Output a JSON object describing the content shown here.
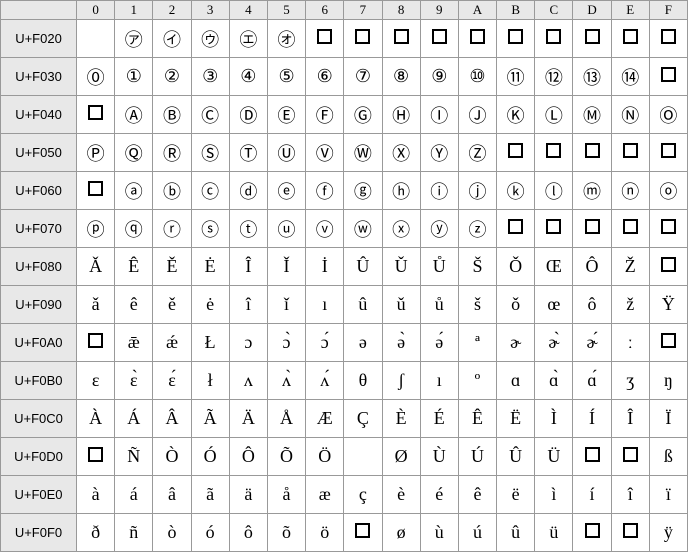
{
  "columns": [
    "0",
    "1",
    "2",
    "3",
    "4",
    "5",
    "6",
    "7",
    "8",
    "9",
    "A",
    "B",
    "C",
    "D",
    "E",
    "F"
  ],
  "rows": [
    {
      "label": "U+F020",
      "cells": [
        "",
        "㋐",
        "㋑",
        "㋒",
        "㋓",
        "㋔",
        "□",
        "□",
        "□",
        "□",
        "□",
        "□",
        "□",
        "□",
        "□",
        "□"
      ]
    },
    {
      "label": "U+F030",
      "cells": [
        "⓪",
        "①",
        "②",
        "③",
        "④",
        "⑤",
        "⑥",
        "⑦",
        "⑧",
        "⑨",
        "⑩",
        "⑪",
        "⑫",
        "⑬",
        "⑭",
        "□"
      ]
    },
    {
      "label": "U+F040",
      "cells": [
        "□",
        "Ⓐ",
        "Ⓑ",
        "Ⓒ",
        "Ⓓ",
        "Ⓔ",
        "Ⓕ",
        "Ⓖ",
        "Ⓗ",
        "Ⓘ",
        "Ⓙ",
        "Ⓚ",
        "Ⓛ",
        "Ⓜ",
        "Ⓝ",
        "Ⓞ"
      ]
    },
    {
      "label": "U+F050",
      "cells": [
        "Ⓟ",
        "Ⓠ",
        "Ⓡ",
        "Ⓢ",
        "Ⓣ",
        "Ⓤ",
        "Ⓥ",
        "Ⓦ",
        "Ⓧ",
        "Ⓨ",
        "Ⓩ",
        "□",
        "□",
        "□",
        "□",
        "□"
      ]
    },
    {
      "label": "U+F060",
      "cells": [
        "□",
        "ⓐ",
        "ⓑ",
        "ⓒ",
        "ⓓ",
        "ⓔ",
        "ⓕ",
        "ⓖ",
        "ⓗ",
        "ⓘ",
        "ⓙ",
        "ⓚ",
        "ⓛ",
        "ⓜ",
        "ⓝ",
        "ⓞ"
      ]
    },
    {
      "label": "U+F070",
      "cells": [
        "ⓟ",
        "ⓠ",
        "ⓡ",
        "ⓢ",
        "ⓣ",
        "ⓤ",
        "ⓥ",
        "ⓦ",
        "ⓧ",
        "ⓨ",
        "ⓩ",
        "□",
        "□",
        "□",
        "□",
        "□"
      ]
    },
    {
      "label": "U+F080",
      "cells": [
        "Ǎ",
        "Ê",
        "Ě",
        "Ė",
        "Î",
        "Ǐ",
        "İ",
        "Û",
        "Ǔ",
        "Ů",
        "Š",
        "Ǒ",
        "Œ",
        "Ô",
        "Ž",
        "□"
      ]
    },
    {
      "label": "U+F090",
      "cells": [
        "ǎ",
        "ê",
        "ě",
        "ė",
        "î",
        "ǐ",
        "ı",
        "û",
        "ǔ",
        "ů",
        "š",
        "ǒ",
        "œ",
        "ô",
        "ž",
        "Ÿ"
      ]
    },
    {
      "label": "U+F0A0",
      "cells": [
        "□",
        "ǣ",
        "ǽ",
        "Ł",
        "ɔ",
        "ɔ̀",
        "ɔ́",
        "ə",
        "ə̀",
        "ə́",
        "ª",
        "ɚ",
        "ɚ̀",
        "ɚ́",
        "ː",
        "□"
      ]
    },
    {
      "label": "U+F0B0",
      "cells": [
        "ɛ",
        "ɛ̀",
        "ɛ́",
        "ł",
        "ʌ",
        "ʌ̀",
        "ʌ́",
        "θ",
        "ʃ",
        "ı",
        "º",
        "ɑ",
        "ɑ̀",
        "ɑ́",
        "ʒ",
        "ŋ"
      ]
    },
    {
      "label": "U+F0C0",
      "cells": [
        "À",
        "Á",
        "Â",
        "Ã",
        "Ä",
        "Å",
        "Æ",
        "Ç",
        "È",
        "É",
        "Ê",
        "Ë",
        "Ì",
        "Í",
        "Î",
        "Ï"
      ]
    },
    {
      "label": "U+F0D0",
      "cells": [
        "□",
        "Ñ",
        "Ò",
        "Ó",
        "Ô",
        "Õ",
        "Ö",
        "",
        "Ø",
        "Ù",
        "Ú",
        "Û",
        "Ü",
        "□",
        "□",
        "ß"
      ]
    },
    {
      "label": "U+F0E0",
      "cells": [
        "à",
        "á",
        "â",
        "ã",
        "ä",
        "å",
        "æ",
        "ç",
        "è",
        "é",
        "ê",
        "ë",
        "ì",
        "í",
        "î",
        "ï"
      ]
    },
    {
      "label": "U+F0F0",
      "cells": [
        "ð",
        "ñ",
        "ò",
        "ó",
        "ô",
        "õ",
        "ö",
        "□",
        "ø",
        "ù",
        "ú",
        "û",
        "ü",
        "□",
        "□",
        "ÿ"
      ]
    }
  ]
}
